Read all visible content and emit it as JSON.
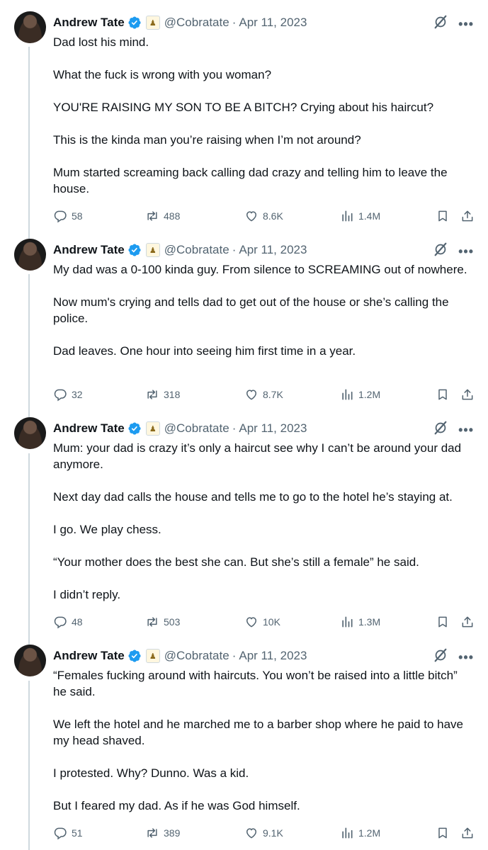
{
  "author": {
    "name": "Andrew Tate",
    "handle": "@Cobratate",
    "affiliate_badge": "♟"
  },
  "tweets": [
    {
      "date": "Apr 11, 2023",
      "paragraphs": [
        "Dad lost his mind.",
        "What the fuck is wrong with you woman?",
        "YOU'RE RAISING MY SON TO BE A BITCH? Crying about his haircut?",
        "This is the kinda man you’re raising when I’m not around?",
        "Mum started screaming back calling dad crazy and telling him to leave the house."
      ],
      "replies": "58",
      "reposts": "488",
      "likes": "8.6K",
      "views": "1.4M"
    },
    {
      "date": "Apr 11, 2023",
      "paragraphs": [
        "My dad was a 0-100 kinda guy. From silence to SCREAMING out of nowhere.",
        "Now mum's crying and tells dad to get out of the house or she’s calling the police.",
        "Dad leaves. One hour into seeing him first time in a year."
      ],
      "replies": "32",
      "reposts": "318",
      "likes": "8.7K",
      "views": "1.2M"
    },
    {
      "date": "Apr 11, 2023",
      "paragraphs": [
        "Mum: your dad is crazy it’s only a haircut see why I can’t be around your dad anymore.",
        "Next day dad calls the house and tells me to go to the hotel he’s staying at.",
        "I go. We play chess.",
        "“Your mother does the best she can. But she’s still a female” he said.",
        "I didn’t reply."
      ],
      "replies": "48",
      "reposts": "503",
      "likes": "10K",
      "views": "1.3M"
    },
    {
      "date": "Apr 11, 2023",
      "paragraphs": [
        "“Females fucking around with haircuts. You won’t be raised into a little bitch” he said.",
        "We left the hotel and he marched me to a barber shop where he paid to have my head shaved.",
        "I protested. Why? Dunno. Was a kid.",
        "But I feared my dad. As if he was God himself."
      ],
      "replies": "51",
      "reposts": "389",
      "likes": "9.1K",
      "views": "1.2M"
    }
  ],
  "icons": {
    "verified": "verified-badge-icon",
    "affiliate": "chess-knight-affiliate-icon",
    "grok": "grok-icon",
    "more": "more-icon",
    "reply": "reply-icon",
    "repost": "repost-icon",
    "like": "like-icon",
    "views": "views-icon",
    "bookmark": "bookmark-icon",
    "share": "share-icon"
  },
  "colors": {
    "verified": "#1d9bf0",
    "muted": "#536471",
    "text": "#0f1419"
  }
}
